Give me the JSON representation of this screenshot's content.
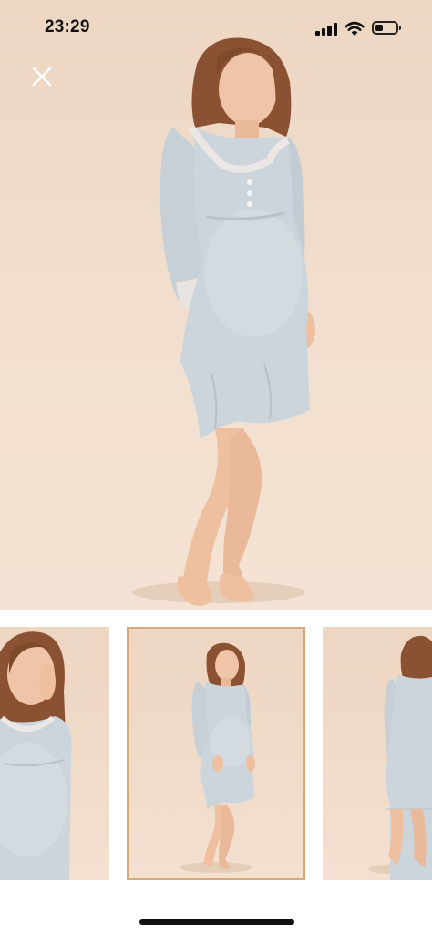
{
  "status_bar": {
    "time": "23:29",
    "signal_icon": "cellular-signal-icon",
    "wifi_icon": "wifi-icon",
    "battery_icon": "battery-icon",
    "battery_level": 0.4
  },
  "viewer": {
    "close_icon": "close-icon",
    "main_image": "maternity-nightdress-front-photo",
    "colors": {
      "background": "#f0dccb",
      "dress": "#c9d2d9",
      "selected_border": "#d9a77c"
    }
  },
  "thumbnails": [
    {
      "image": "model-closeup-thumbnail",
      "selected": false
    },
    {
      "image": "model-full-front-thumbnail",
      "selected": true
    },
    {
      "image": "model-back-view-thumbnail",
      "selected": false
    }
  ]
}
